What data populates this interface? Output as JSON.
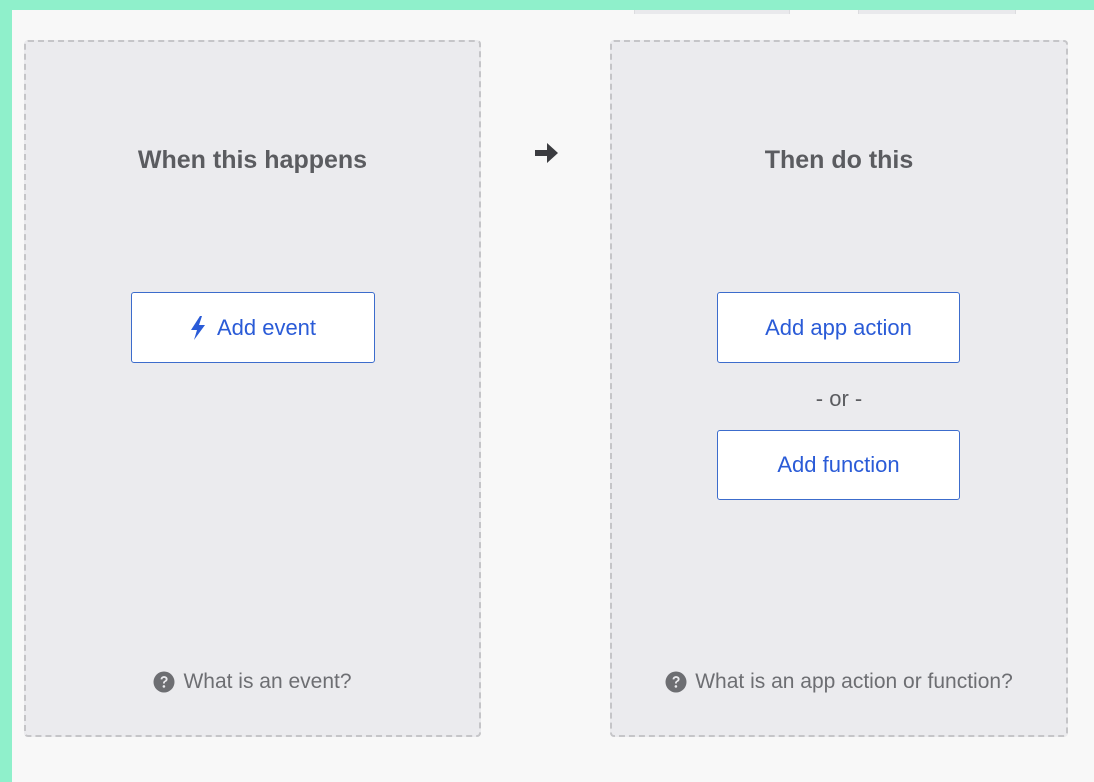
{
  "trigger_panel": {
    "title": "When this happens",
    "add_event_label": "Add event",
    "help_text": "What is an event?"
  },
  "action_panel": {
    "title": "Then do this",
    "add_app_action_label": "Add app action",
    "separator_text": "- or -",
    "add_function_label": "Add function",
    "help_text": "What is an app action or function?"
  },
  "icons": {
    "event_button_icon": "lightning-bolt-icon",
    "help_icon": "question-circle-icon",
    "flow_icon": "arrow-right-icon"
  },
  "colors": {
    "accent": "#2a5bd7",
    "panel_background": "#ebebee",
    "page_background": "#f8f8f8",
    "frame": "#8ff0cb"
  }
}
